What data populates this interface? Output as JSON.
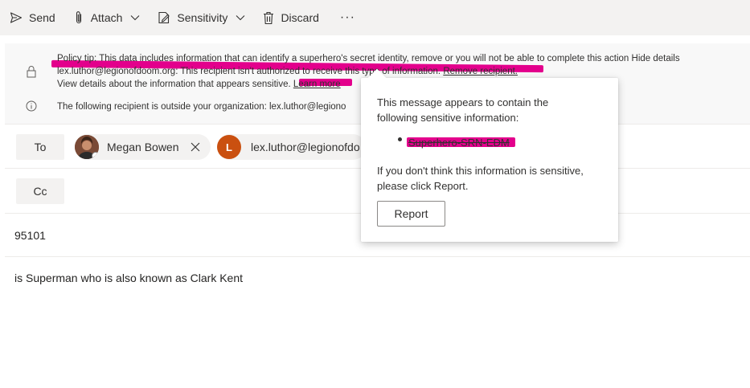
{
  "toolbar": {
    "send_label": "Send",
    "attach_label": "Attach",
    "sensitivity_label": "Sensitivity",
    "discard_label": "Discard",
    "more_label": "···"
  },
  "policy": {
    "tip_text": "Policy tip: This data includes information that can identify a superhero's secret identity, remove or you will not be able to complete this action",
    "hide_details": "Hide details",
    "recipient_text": "lex.luthor@legionofdoom.org: This recipient isn't authorized to receive this type of information.",
    "remove_recipient": "Remove recipient.",
    "view_details": "View details about the information that appears sensitive.",
    "learn_more": "Learn more",
    "external_text": "The following recipient is outside your organization: lex.luthor@legiono",
    "icons": [
      "lock-icon",
      "info-icon"
    ],
    "highlight_color": "#e3008c"
  },
  "compose": {
    "to_label": "To",
    "cc_label": "Cc",
    "recipients": [
      {
        "name": "Megan Bowen",
        "avatar": "photo"
      },
      {
        "name": "lex.luthor@legionofdo",
        "initial": "L",
        "avatar_color": "#ca5010"
      }
    ],
    "subject": "95101",
    "body": "is Superman who is also known as Clark Kent"
  },
  "popup": {
    "intro": "This message appears to contain the following sensitive information:",
    "item": "Superhero-SRN-EDM",
    "note": "If you don't think this information is sensitive, please click Report.",
    "report_label": "Report"
  }
}
